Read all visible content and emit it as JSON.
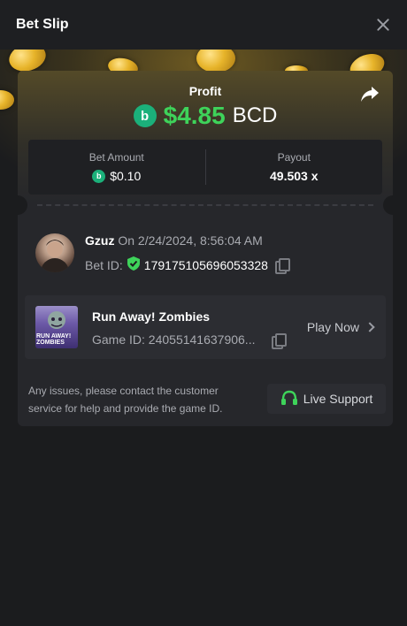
{
  "header": {
    "title": "Bet Slip"
  },
  "profit": {
    "label": "Profit",
    "amount": "$4.85",
    "currency": "BCD"
  },
  "stats": {
    "bet_amount_label": "Bet Amount",
    "bet_amount_value": "$0.10",
    "payout_label": "Payout",
    "payout_value": "49.503 x"
  },
  "bet": {
    "username": "Gzuz",
    "date_text": "On 2/24/2024, 8:56:04 AM",
    "bet_id_label": "Bet ID:",
    "bet_id_value": "179175105696053328"
  },
  "game": {
    "name": "Run Away! Zombies",
    "thumb_text": "RUN AWAY! ZOMBIES",
    "id_label": "Game ID:",
    "id_value": "24055141637906...",
    "play_label": "Play Now"
  },
  "support": {
    "message": "Any issues, please contact the customer service for help and provide the game ID.",
    "button_label": "Live Support"
  },
  "colors": {
    "accent_green": "#3ed35a",
    "bcd_green": "#1bb07a",
    "background": "#1b1c1e",
    "card": "#26272b"
  },
  "icons": [
    "close-icon",
    "share-icon",
    "bcd-coin-icon",
    "verified-shield-icon",
    "copy-icon",
    "chevron-right-icon",
    "headset-icon"
  ]
}
